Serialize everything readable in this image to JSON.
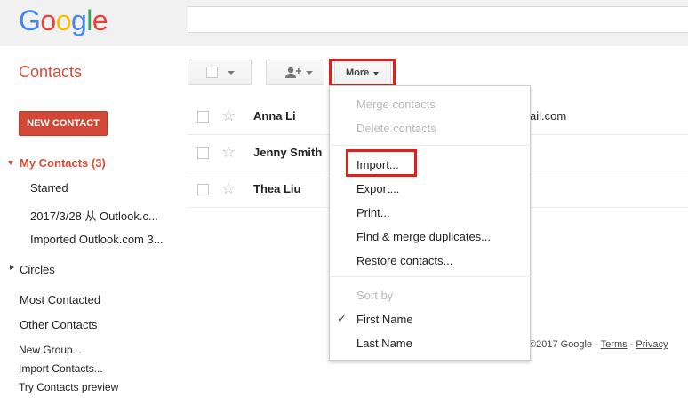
{
  "header": {
    "logo_letters": [
      "G",
      "o",
      "o",
      "g",
      "l",
      "e"
    ],
    "search_value": ""
  },
  "app": {
    "title": "Contacts"
  },
  "toolbar": {
    "more_label": "More"
  },
  "sidebar": {
    "new_contact_label": "NEW CONTACT",
    "my_contacts_label": "My Contacts (3)",
    "groups": [
      "Starred",
      "2017/3/28 从 Outlook.c...",
      "Imported Outlook.com 3..."
    ],
    "circles_label": "Circles",
    "most_contacted": "Most Contacted",
    "other_contacts": "Other Contacts",
    "new_group": "New Group...",
    "import_contacts": "Import Contacts...",
    "try_preview": "Try Contacts preview"
  },
  "contacts": [
    {
      "name": "Anna Li",
      "email_fragment": "ail.com"
    },
    {
      "name": "Jenny Smith",
      "email_fragment": ""
    },
    {
      "name": "Thea Liu",
      "email_fragment": ""
    }
  ],
  "menu": {
    "merge_contacts": "Merge contacts",
    "delete_contacts": "Delete contacts",
    "import": "Import...",
    "export": "Export...",
    "print": "Print...",
    "find_merge": "Find & merge duplicates...",
    "restore": "Restore contacts...",
    "sort_by": "Sort by",
    "first_name": "First Name",
    "last_name": "Last Name",
    "checkmark": "✓"
  },
  "footer": {
    "copyright": "©2017 Google - ",
    "terms": "Terms",
    "separator": " - ",
    "privacy": "Privacy"
  },
  "colors": {
    "accent_red": "#dd4b39",
    "button_red": "#d14836",
    "highlight_red": "#e0201b"
  }
}
